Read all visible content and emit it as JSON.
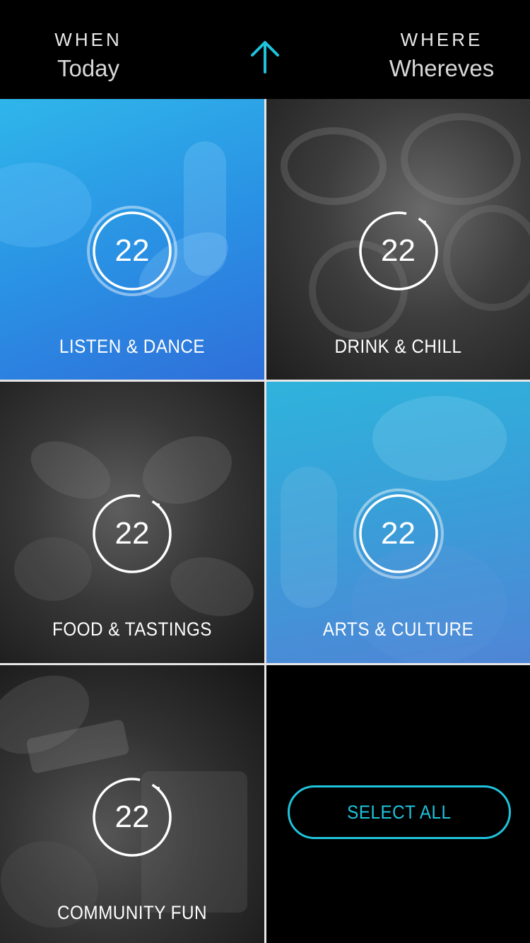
{
  "header": {
    "when_label": "WHEN",
    "when_value": "Today",
    "where_label": "WHERE",
    "where_value": "Whereves",
    "arrow_icon": "arrow-up-icon",
    "accent": "#1fc3dc"
  },
  "categories": [
    {
      "label": "LISTEN & DANCE",
      "count": "22",
      "selected": true
    },
    {
      "label": "DRINK & CHILL",
      "count": "22",
      "selected": false
    },
    {
      "label": "FOOD & TASTINGS",
      "count": "22",
      "selected": false
    },
    {
      "label": "ARTS & CULTURE",
      "count": "22",
      "selected": true
    },
    {
      "label": "COMMUNITY FUN",
      "count": "22",
      "selected": false
    }
  ],
  "select_all_label": "SELECT ALL"
}
